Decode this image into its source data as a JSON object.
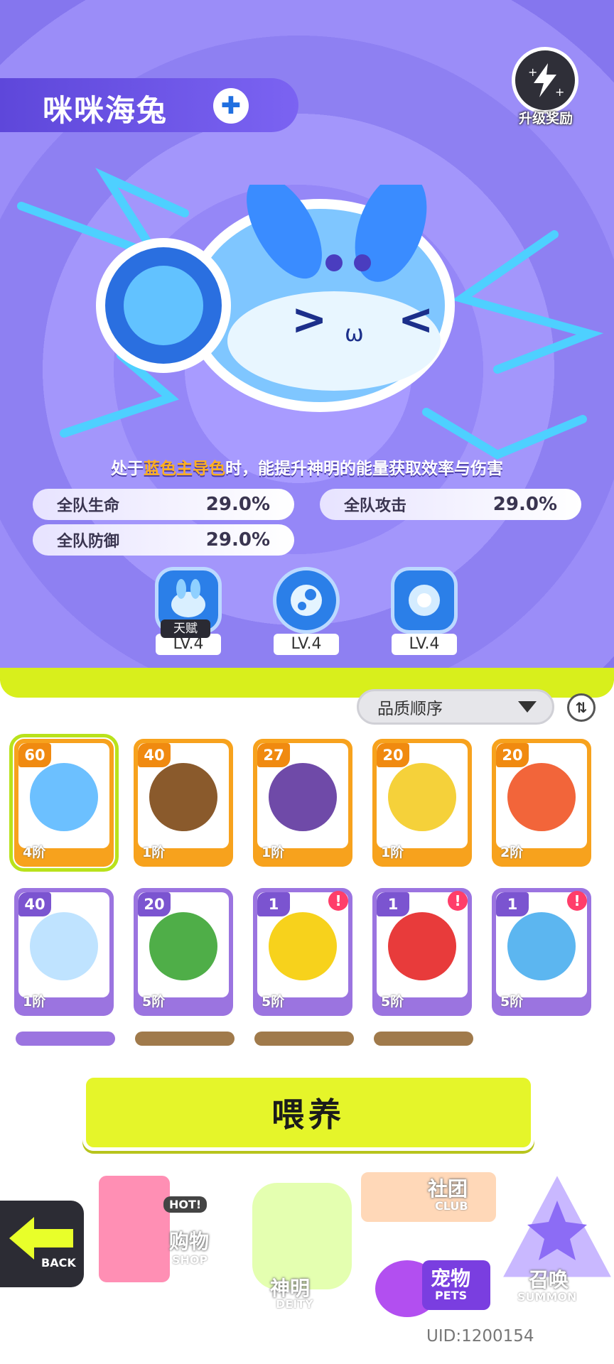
{
  "header": {
    "pet_name": "咪咪海兔",
    "element_icon": "water-cross-icon",
    "upgrade_reward_label": "升级奖励"
  },
  "description": {
    "prefix": "处于",
    "highlight": "蓝色主导色",
    "suffix": "时，能提升神明的能量获取效率与伤害"
  },
  "stats": [
    {
      "label": "全队生命",
      "value": "29.0%"
    },
    {
      "label": "全队攻击",
      "value": "29.0%"
    },
    {
      "label": "全队防御",
      "value": "29.0%"
    }
  ],
  "skills": [
    {
      "icon": "bunny-skill-icon",
      "tag": "天赋",
      "level": "LV.4"
    },
    {
      "icon": "bubble-skill-icon",
      "level": "LV.4"
    },
    {
      "icon": "anemone-skill-icon",
      "level": "LV.4"
    }
  ],
  "sort": {
    "label": "品质顺序",
    "swap_icon": "sort-swap-icon"
  },
  "pets": [
    {
      "level": "60",
      "rank": "4阶",
      "frame": "orange",
      "color": "#6cc0ff",
      "selected": true
    },
    {
      "level": "40",
      "rank": "1阶",
      "frame": "orange",
      "color": "#8a5a2c"
    },
    {
      "level": "27",
      "rank": "1阶",
      "frame": "orange",
      "color": "#6f4aa8"
    },
    {
      "level": "20",
      "rank": "1阶",
      "frame": "orange",
      "color": "#f5d13a"
    },
    {
      "level": "20",
      "rank": "2阶",
      "frame": "orange",
      "color": "#f2653a"
    },
    {
      "level": "40",
      "rank": "1阶",
      "frame": "purple",
      "color": "#bfe3ff"
    },
    {
      "level": "20",
      "rank": "5阶",
      "frame": "purple",
      "color": "#4fae48"
    },
    {
      "level": "1",
      "rank": "5阶",
      "frame": "purple",
      "color": "#f7d21c",
      "alert": "!"
    },
    {
      "level": "1",
      "rank": "5阶",
      "frame": "purple",
      "color": "#e83b3b",
      "alert": "!"
    },
    {
      "level": "1",
      "rank": "5阶",
      "frame": "purple",
      "color": "#5cb6f0",
      "alert": "!"
    }
  ],
  "feed_button": "喂养",
  "nav": {
    "back": "BACK",
    "shop_cn": "购物",
    "shop_en": "SHOP",
    "shop_badge": "HOT!",
    "deity_cn": "神明",
    "deity_en": "DEITY",
    "club_cn": "社团",
    "club_en": "CLUB",
    "pets_cn": "宠物",
    "pets_en": "PETS",
    "summon_cn": "召唤",
    "summon_en": "SUMMON"
  },
  "uid": "UID:1200154"
}
